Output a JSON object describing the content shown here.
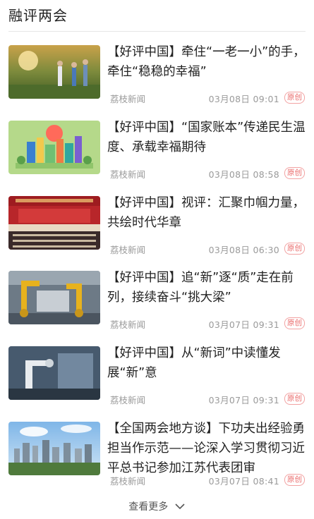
{
  "section": {
    "title": "融评两会"
  },
  "items": [
    {
      "headline": "【好评中国】牵住“一老一小”的手，牵住“稳稳的幸福”",
      "source": "荔枝新闻",
      "time": "03月08日 09:01",
      "badge": "原创",
      "thumb": "thumb-elderly-exercise"
    },
    {
      "headline": "【好评中国】“国家账本”传递民生温度、承载幸福期待",
      "source": "荔枝新闻",
      "time": "03月08日 08:58",
      "badge": "原创",
      "thumb": "thumb-city-illustration"
    },
    {
      "headline": "【好评中国】视评：汇聚巾帼力量，共绘时代华章",
      "source": "荔枝新闻",
      "time": "03月08日 06:30",
      "badge": "原创",
      "thumb": "thumb-conference-hall"
    },
    {
      "headline": "【好评中国】追“新”逐“质”走在前列，接续奋斗“挑大梁”",
      "source": "荔枝新闻",
      "time": "03月07日 09:31",
      "badge": "原创",
      "thumb": "thumb-factory-robots"
    },
    {
      "headline": "【好评中国】从“新词”中读懂发展“新”意",
      "source": "荔枝新闻",
      "time": "03月07日 09:31",
      "badge": "原创",
      "thumb": "thumb-lab-robot"
    },
    {
      "headline": "【全国两会地方谈】下功夫出经验勇担当作示范——论深入学习贯彻习近平总书记参加江苏代表团审",
      "source": "荔枝新闻",
      "time": "03月07日 08:41",
      "badge": "原创",
      "thumb": "thumb-city-skyline"
    }
  ],
  "footer": {
    "more_label": "查看更多"
  }
}
